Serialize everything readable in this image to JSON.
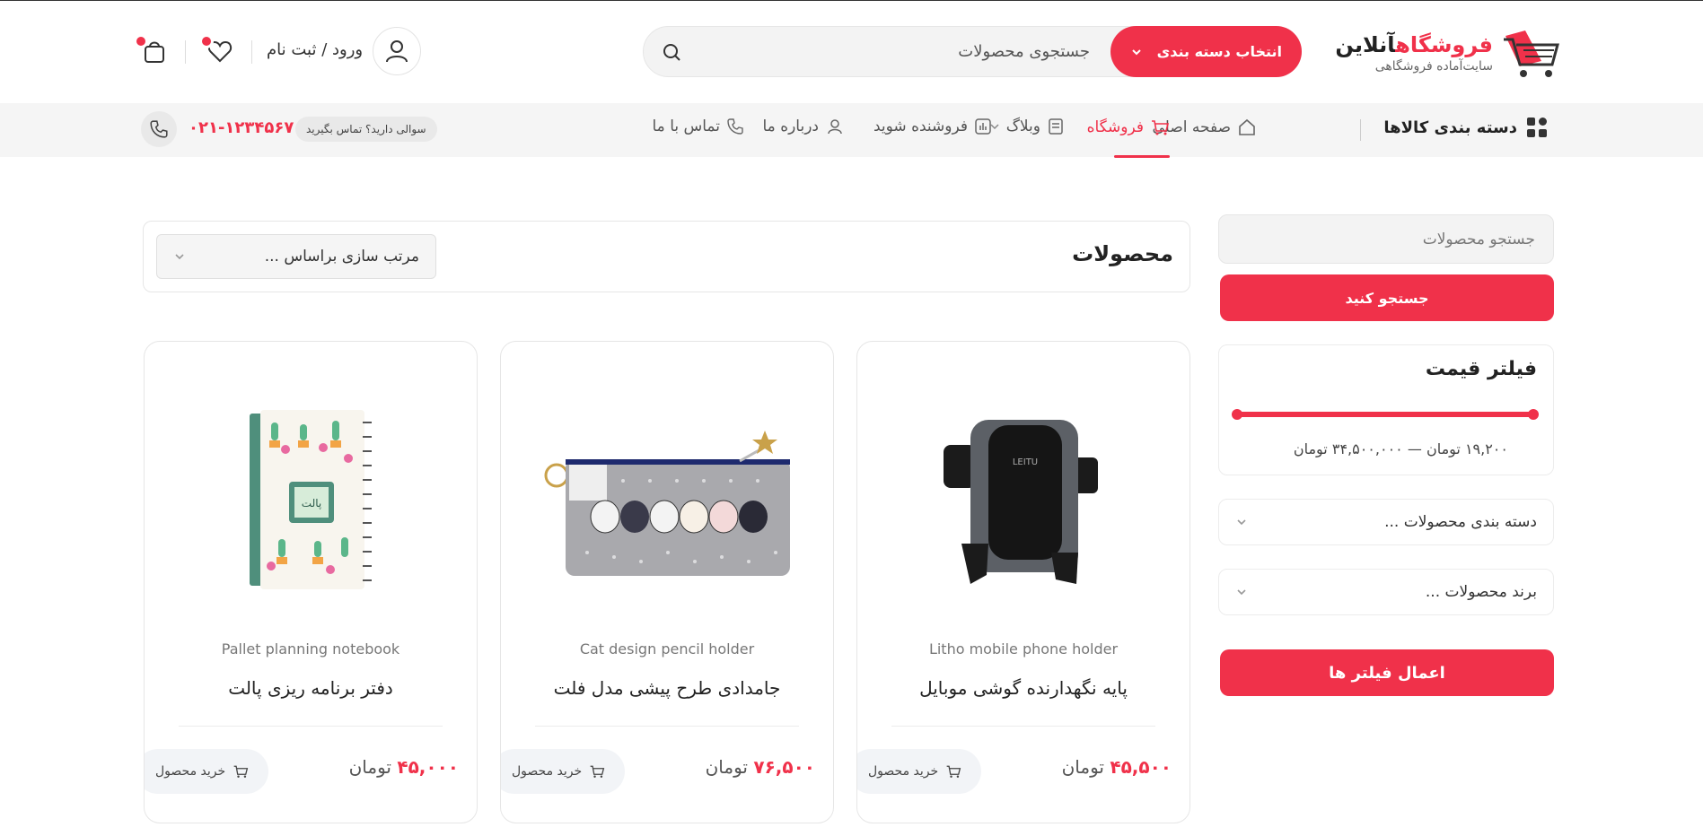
{
  "header": {
    "logo_title_part1": "فروشگاه",
    "logo_title_part2": "آنلاین",
    "logo_subtitle": "سایت‌آماده فروشگاهی",
    "category_button": "انتخاب دسته بندی",
    "search_placeholder": "جستجوی محصولات",
    "login_label": "ورود / ثبت نام"
  },
  "nav": {
    "categories_label": "دسته بندی کالاها",
    "items": [
      {
        "label": "صفحه اصلی",
        "icon": "home-icon"
      },
      {
        "label": "فروشگاه",
        "icon": "cart-icon",
        "active": true
      },
      {
        "label": "وبلاگ",
        "icon": "document-icon"
      },
      {
        "label": "فروشنده شوید",
        "icon": "chart-icon"
      },
      {
        "label": "درباره ما",
        "icon": "users-icon"
      },
      {
        "label": "تماس با ما",
        "icon": "phone-icon"
      }
    ],
    "question_text": "سوالی دارید؟ تماس بگیرید",
    "phone": "۰۲۱-۱۲۳۴۵۶۷"
  },
  "sidebar": {
    "search_placeholder": "جستجو محصولات",
    "search_button": "جستجو کنید",
    "price_filter_title": "فیلتر قیمت",
    "price_range": "۱۹,۲۰۰ تومان — ۳۴,۵۰۰,۰۰۰ تومان",
    "category_dropdown": "دسته بندی محصولات ...",
    "brand_dropdown": "برند محصولات ...",
    "apply_button": "اعمال فیلتر ها"
  },
  "main": {
    "title": "محصولات",
    "sort_label": "مرتب سازی براساس ..."
  },
  "products": [
    {
      "name_en": "Litho mobile phone holder",
      "name_fa": "پایه نگهدارنده گوشی موبایل",
      "price": "۴۵,۵۰۰",
      "currency": "تومان",
      "buy_label": "خرید محصول"
    },
    {
      "name_en": "Cat design pencil holder",
      "name_fa": "جامدادی طرح پیشی مدل فلت",
      "price": "۷۶,۵۰۰",
      "currency": "تومان",
      "buy_label": "خرید محصول"
    },
    {
      "name_en": "Pallet planning notebook",
      "name_fa": "دفتر برنامه ریزی پالت",
      "price": "۴۵,۰۰۰",
      "currency": "تومان",
      "buy_label": "خرید محصول"
    }
  ],
  "colors": {
    "accent": "#f0314a",
    "nav_bg": "#f5f5f5"
  }
}
